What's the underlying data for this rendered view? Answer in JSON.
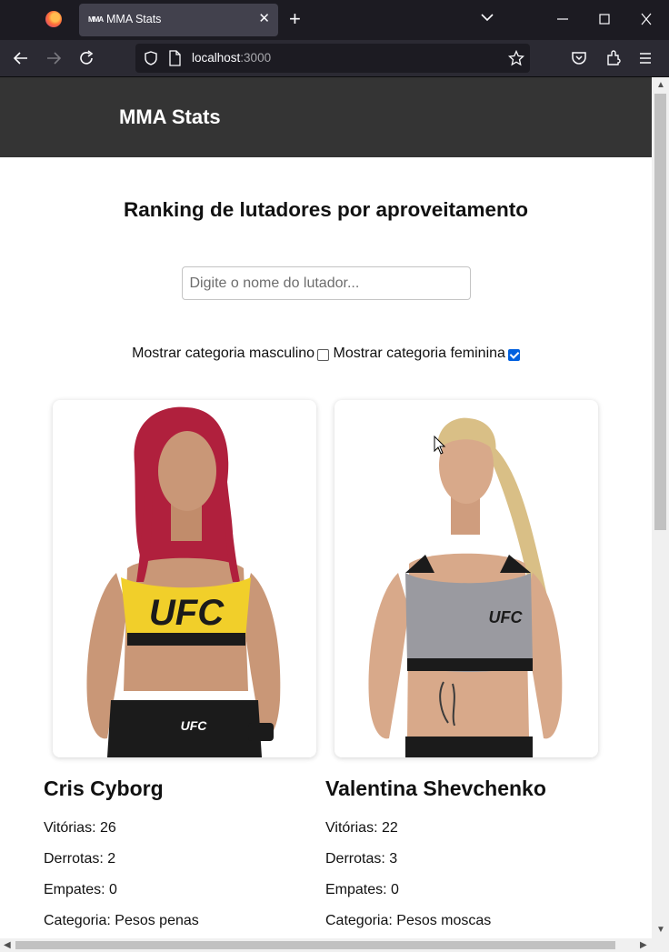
{
  "browser": {
    "tab_title": "MMA Stats",
    "tab_favicon_text": "MMA",
    "url_host": "localhost",
    "url_port": ":3000",
    "new_tab_symbol": "+",
    "close_tab_symbol": "✕"
  },
  "site": {
    "title": "MMA Stats"
  },
  "page": {
    "heading": "Ranking de lutadores por aproveitamento",
    "search_placeholder": "Digite o nome do lutador...",
    "search_value": "",
    "filter_male_label": "Mostrar categoria masculino",
    "filter_male_checked": false,
    "filter_female_label": "Mostrar categoria feminina",
    "filter_female_checked": true
  },
  "fighters": [
    {
      "name": "Cris Cyborg",
      "wins": "Vitórias: 26",
      "losses": "Derrotas: 2",
      "draws": "Empates: 0",
      "category": "Categoria: Pesos penas",
      "hair_color": "#b0203d",
      "top_color": "#f1cf2a"
    },
    {
      "name": "Valentina Shevchenko",
      "wins": "Vitórias: 22",
      "losses": "Derrotas: 3",
      "draws": "Empates: 0",
      "category": "Categoria: Pesos moscas",
      "hair_color": "#d9bf86",
      "top_color": "#9a9aa0"
    }
  ],
  "colors": {
    "header_bg": "#343434",
    "checkbox_accent": "#0060df",
    "browser_bg": "#1c1b22"
  }
}
